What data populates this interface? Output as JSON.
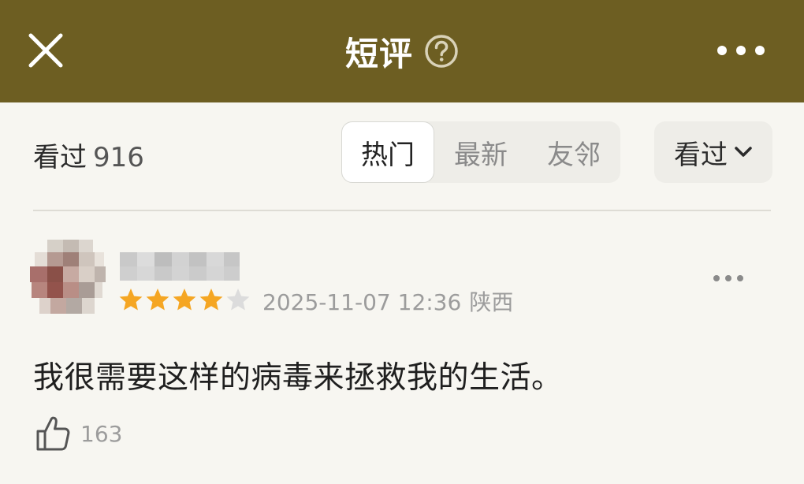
{
  "header": {
    "title": "短评",
    "icons": {
      "close": "close-icon",
      "help": "question-circle-icon",
      "more": "more-horizontal-icon"
    },
    "colors": {
      "background": "#6d5e22",
      "foreground": "#ffffff"
    }
  },
  "filter": {
    "seen_label": "看过",
    "seen_count": "916",
    "tabs": [
      {
        "label": "热门",
        "active": true
      },
      {
        "label": "最新",
        "active": false
      },
      {
        "label": "友邻",
        "active": false
      }
    ],
    "sort_label": "看过",
    "sort_icon": "chevron-down-icon"
  },
  "comment": {
    "avatar": "blurred-avatar",
    "username_hidden": true,
    "rating": 4,
    "rating_max": 5,
    "date": "2025-11-07 12:36",
    "location": "陕西",
    "text": "我很需要这样的病毒来拯救我的生活。",
    "likes": "163",
    "like_icon": "thumbs-up-icon",
    "more_icon": "more-horizontal-icon",
    "colors": {
      "star_filled": "#f5a623",
      "star_empty": "#dcdcdc"
    }
  }
}
